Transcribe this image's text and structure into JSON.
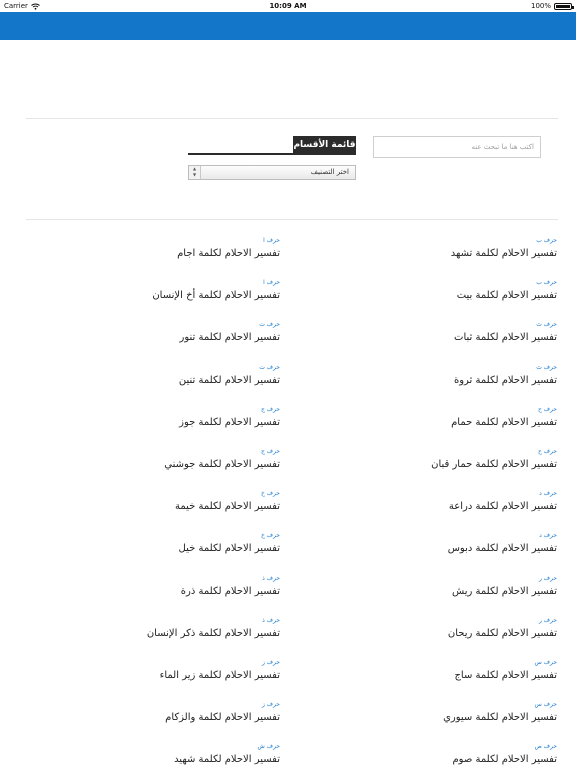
{
  "status_bar": {
    "carrier": "Carrier",
    "time": "10:09 AM",
    "battery": "100%"
  },
  "search": {
    "placeholder": "اكتب هنا ما تبحث عنه"
  },
  "categories_tab": {
    "label": "قائمة الأقسام"
  },
  "category_select": {
    "selected": "اختر التصنيف"
  },
  "entries_right": [
    {
      "letter": "حرف ب",
      "title": "تفسير الاحلام لكلمة تشهد"
    },
    {
      "letter": "حرف ب",
      "title": "تفسير الاحلام لكلمة بيت"
    },
    {
      "letter": "حرف ث",
      "title": "تفسير الاحلام لكلمة ثبات"
    },
    {
      "letter": "حرف ث",
      "title": "تفسير الاحلام لكلمة ثروة"
    },
    {
      "letter": "حرف ح",
      "title": "تفسير الاحلام لكلمة حمام"
    },
    {
      "letter": "حرف ح",
      "title": "تفسير الاحلام لكلمة حمار قبان"
    },
    {
      "letter": "حرف د",
      "title": "تفسير الاحلام لكلمة دراعة"
    },
    {
      "letter": "حرف د",
      "title": "تفسير الاحلام لكلمة دبوس"
    },
    {
      "letter": "حرف ر",
      "title": "تفسير الاحلام لكلمة ريش"
    },
    {
      "letter": "حرف ر",
      "title": "تفسير الاحلام لكلمة ريحان"
    },
    {
      "letter": "حرف س",
      "title": "تفسير الاحلام لكلمة ساج"
    },
    {
      "letter": "حرف س",
      "title": "تفسير الاحلام لكلمة سيوري"
    },
    {
      "letter": "حرف ص",
      "title": "تفسير الاحلام لكلمة صوم"
    }
  ],
  "entries_left": [
    {
      "letter": "حرف ا",
      "title": "تفسير الاحلام لكلمة اجام"
    },
    {
      "letter": "حرف ا",
      "title": "تفسير الاحلام لكلمة أخ الإنسان"
    },
    {
      "letter": "حرف ت",
      "title": "تفسير الاحلام لكلمة تنور"
    },
    {
      "letter": "حرف ت",
      "title": "تفسير الاحلام لكلمة تنين"
    },
    {
      "letter": "حرف ج",
      "title": "تفسير الاحلام لكلمة جوز"
    },
    {
      "letter": "حرف ج",
      "title": "تفسير الاحلام لكلمة جوشني"
    },
    {
      "letter": "حرف خ",
      "title": "تفسير الاحلام لكلمة خيمة"
    },
    {
      "letter": "حرف خ",
      "title": "تفسير الاحلام لكلمة خيل"
    },
    {
      "letter": "حرف ذ",
      "title": "تفسير الاحلام لكلمة ذرة"
    },
    {
      "letter": "حرف ذ",
      "title": "تفسير الاحلام لكلمة ذكر الإنسان"
    },
    {
      "letter": "حرف ز",
      "title": "تفسير الاحلام لكلمة زير الماء"
    },
    {
      "letter": "حرف ز",
      "title": "تفسير الاحلام لكلمة والزكام"
    },
    {
      "letter": "حرف ش",
      "title": "تفسير الاحلام لكلمة شهيد"
    }
  ]
}
